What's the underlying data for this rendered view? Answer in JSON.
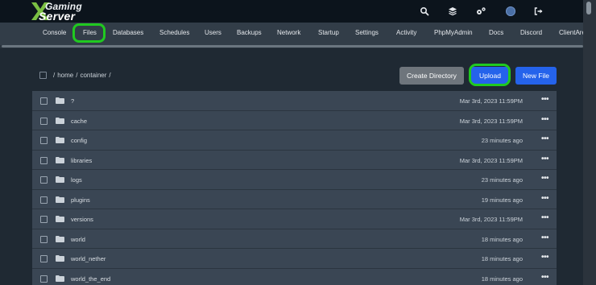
{
  "brand": {
    "line1": "Gaming",
    "line2": "Server",
    "mark": "X"
  },
  "topbar": {
    "icons": [
      "search-icon",
      "layers-icon",
      "gears-icon",
      "avatar",
      "logout-icon"
    ]
  },
  "nav": {
    "items": [
      {
        "label": "Console"
      },
      {
        "label": "Files"
      },
      {
        "label": "Databases"
      },
      {
        "label": "Schedules"
      },
      {
        "label": "Users"
      },
      {
        "label": "Backups"
      },
      {
        "label": "Network"
      },
      {
        "label": "Startup"
      },
      {
        "label": "Settings"
      },
      {
        "label": "Activity"
      },
      {
        "label": "PhpMyAdmin"
      },
      {
        "label": "Docs"
      },
      {
        "label": "Discord"
      },
      {
        "label": "ClientArea"
      }
    ],
    "active": "Files"
  },
  "breadcrumb": {
    "parts": [
      "/",
      "home",
      "/",
      "container",
      "/"
    ]
  },
  "buttons": {
    "create_directory": "Create Directory",
    "upload": "Upload",
    "new_file": "New File"
  },
  "files": [
    {
      "name": "?",
      "modified": "Mar 3rd, 2023 11:59PM"
    },
    {
      "name": "cache",
      "modified": "Mar 3rd, 2023 11:59PM"
    },
    {
      "name": "config",
      "modified": "23 minutes ago"
    },
    {
      "name": "libraries",
      "modified": "Mar 3rd, 2023 11:59PM"
    },
    {
      "name": "logs",
      "modified": "23 minutes ago"
    },
    {
      "name": "plugins",
      "modified": "19 minutes ago"
    },
    {
      "name": "versions",
      "modified": "Mar 3rd, 2023 11:59PM"
    },
    {
      "name": "world",
      "modified": "18 minutes ago"
    },
    {
      "name": "world_nether",
      "modified": "18 minutes ago"
    },
    {
      "name": "world_the_end",
      "modified": "18 minutes ago"
    }
  ],
  "row_menu_glyph": "•••",
  "colors": {
    "topbar": "#0c141c",
    "navbar": "#323d48",
    "background": "#1f2933",
    "row": "#3a4654",
    "primary_button": "#2563eb",
    "secondary_button": "#6e757c",
    "highlight": "#20c920"
  }
}
